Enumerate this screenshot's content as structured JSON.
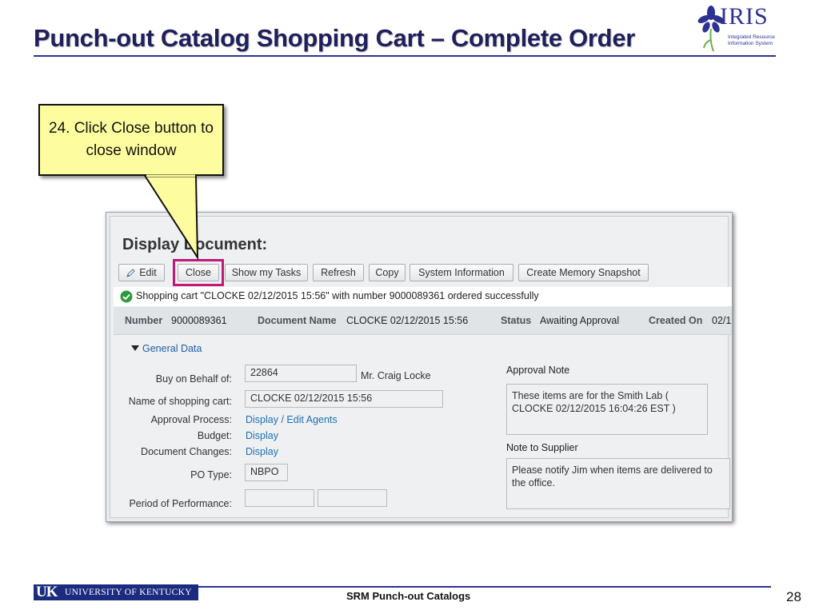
{
  "slide": {
    "title": "Punch-out Catalog Shopping Cart – Complete Order",
    "logo": {
      "word": "IRIS",
      "line1": "Integrated Resource",
      "line2": "Information System",
      "color": "#2e3192"
    },
    "callout": {
      "text": "24. Click Close button to close window",
      "background": "#fdfd9f"
    },
    "footer": {
      "university": "UNIVERSITY OF KENTUCKY",
      "uk_mark": "UK",
      "center_text": "SRM Punch-out Catalogs",
      "page_number": "28"
    },
    "accent_color": "#2e3192",
    "highlight_color": "#c0197a"
  },
  "screen": {
    "title": "Display Document:",
    "toolbar": [
      {
        "label": "Edit",
        "icon": "pencil-icon"
      },
      {
        "label": "Close",
        "highlighted": true
      },
      {
        "label": "Show my Tasks"
      },
      {
        "label": "Refresh"
      },
      {
        "label": "Copy"
      },
      {
        "label": "System Information"
      },
      {
        "label": "Create Memory Snapshot"
      }
    ],
    "message": {
      "icon": "check-circle-icon",
      "text": "Shopping cart \"CLOCKE 02/12/2015 15:56\" with number 9000089361 ordered successfully",
      "color": "#2e9a3a"
    },
    "header": {
      "number_label": "Number",
      "number_value": "9000089361",
      "doc_name_label": "Document Name",
      "doc_name_value": "CLOCKE 02/12/2015 15:56",
      "status_label": "Status",
      "status_value": "Awaiting Approval",
      "created_label": "Created On",
      "created_value": "02/1"
    },
    "general_data": {
      "section_label": "General Data",
      "buy_on_behalf_label": "Buy on Behalf of:",
      "buy_on_behalf_value": "22864",
      "buy_on_behalf_name": "Mr. Craig Locke",
      "cart_name_label": "Name of shopping cart:",
      "cart_name_value": "CLOCKE 02/12/2015 15:56",
      "approval_process_label": "Approval Process:",
      "approval_process_link": "Display / Edit Agents",
      "budget_label": "Budget:",
      "budget_link": "Display",
      "document_changes_label": "Document Changes:",
      "document_changes_link": "Display",
      "po_type_label": "PO Type:",
      "po_type_value": "NBPO",
      "period_label": "Period of Performance:",
      "period_from": "",
      "period_to": ""
    },
    "notes": {
      "approval_label": "Approval Note",
      "approval_text": "These items are for the Smith Lab ( CLOCKE 02/12/2015 16:04:26 EST )",
      "supplier_label": "Note to Supplier",
      "supplier_text": "Please notify Jim when items are delivered to the office."
    }
  }
}
